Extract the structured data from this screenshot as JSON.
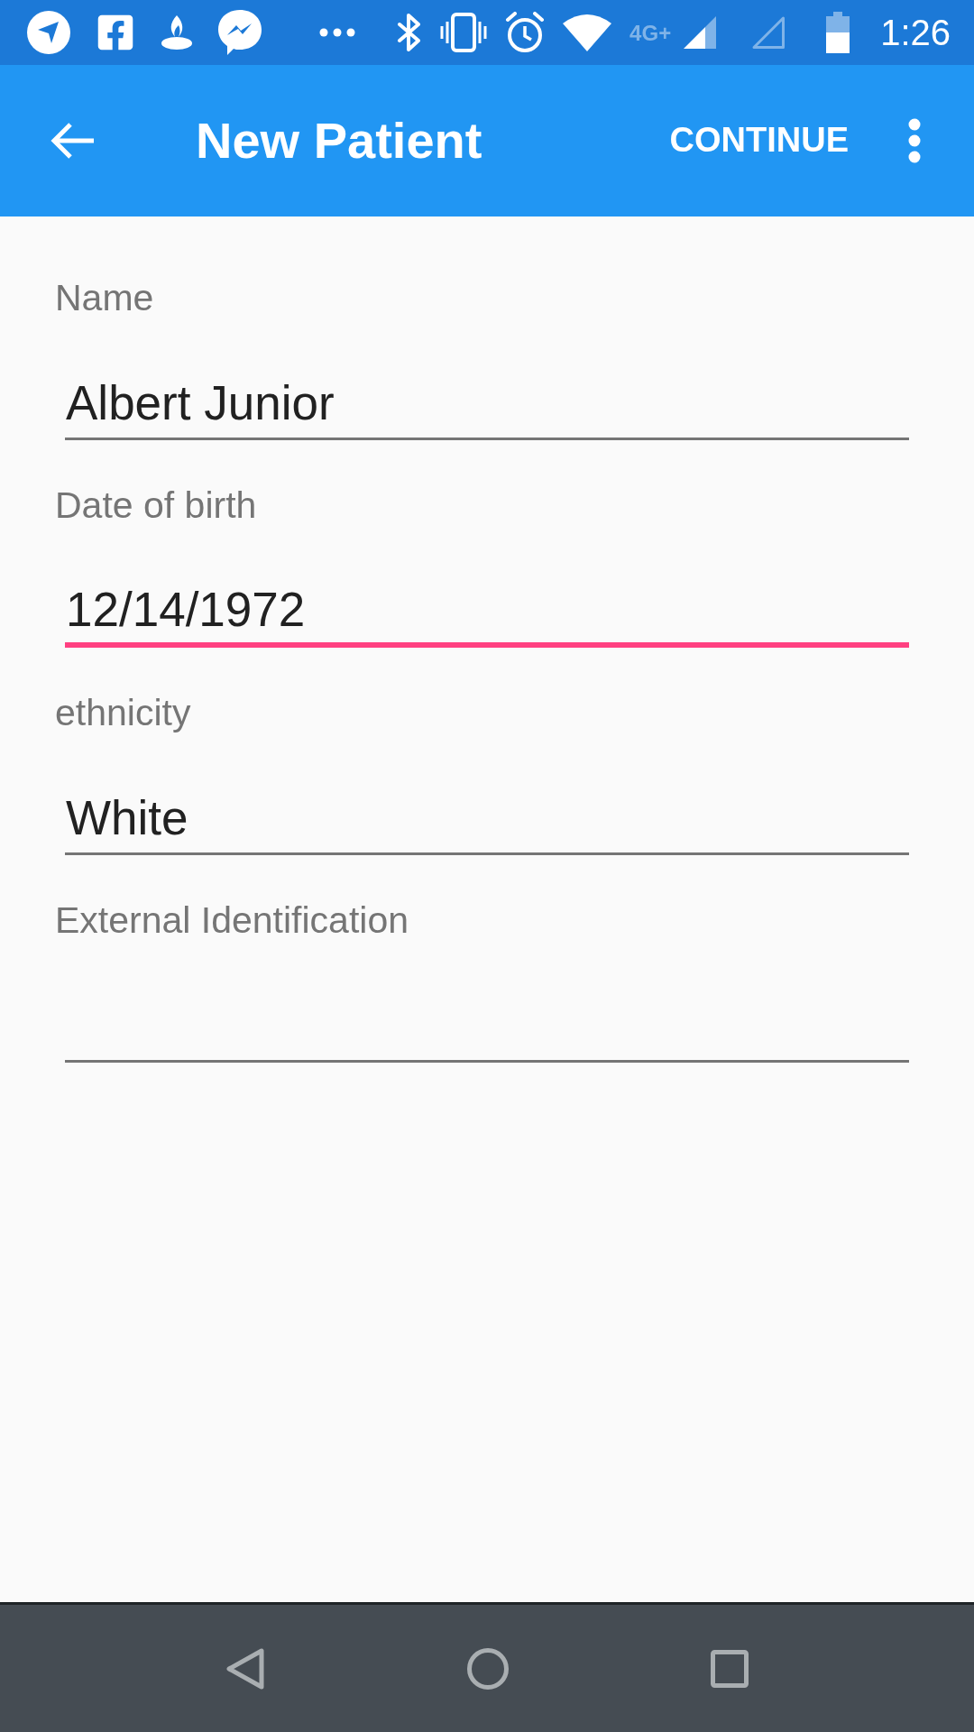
{
  "status_bar": {
    "network_type": "4G+",
    "time": "1:26"
  },
  "app_bar": {
    "title": "New Patient",
    "action": "CONTINUE"
  },
  "form": {
    "fields": [
      {
        "label": "Name",
        "value": "Albert Junior",
        "focused": false
      },
      {
        "label": "Date of birth",
        "value": "12/14/1972",
        "focused": true
      },
      {
        "label": "ethnicity",
        "value": "White",
        "focused": false
      },
      {
        "label": "External Identification",
        "focused": false
      }
    ]
  }
}
